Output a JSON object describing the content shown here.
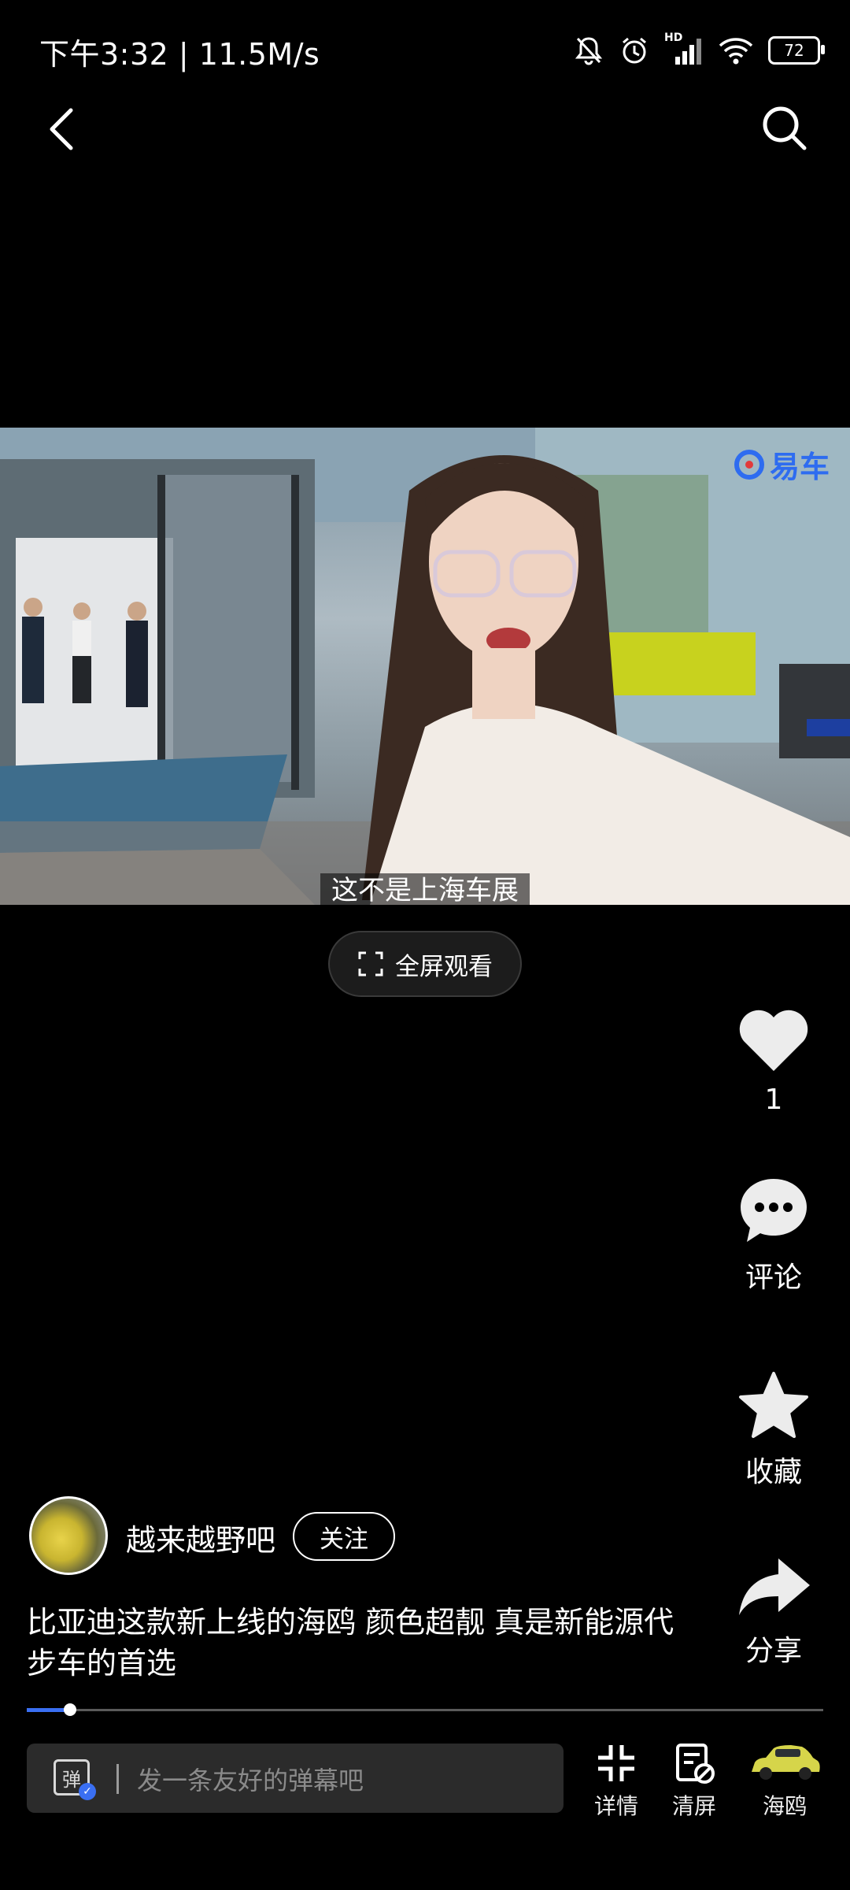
{
  "status_bar": {
    "time": "下午3:32 | 11.5M/s",
    "battery": "72",
    "signal_badge": "HD",
    "icons": [
      "bell-muted-icon",
      "alarm-icon",
      "signal-icon",
      "wifi-icon",
      "battery-icon"
    ]
  },
  "nav": {
    "back_icon": "back-chevron-icon",
    "search_icon": "search-icon"
  },
  "video": {
    "watermark": "易车",
    "subtitle": "这不是上海车展",
    "fullscreen_label": "全屏观看"
  },
  "actions": {
    "like_count": "1",
    "comment_label": "评论",
    "favorite_label": "收藏",
    "share_label": "分享"
  },
  "author": {
    "name": "越来越野吧",
    "follow_label": "关注"
  },
  "caption": "比亚迪这款新上线的海鸥 颜色超靓 真是新能源代步车的首选",
  "progress": {
    "fraction": 0.054
  },
  "bottom_bar": {
    "danmaku_icon_text": "弹",
    "danmaku_placeholder": "发一条友好的弹幕吧",
    "details_label": "详情",
    "clear_label": "清屏",
    "car_label": "海鸥"
  },
  "colors": {
    "accent": "#3a6ff2",
    "background": "#000000",
    "watermark": "#2e6cf0"
  }
}
